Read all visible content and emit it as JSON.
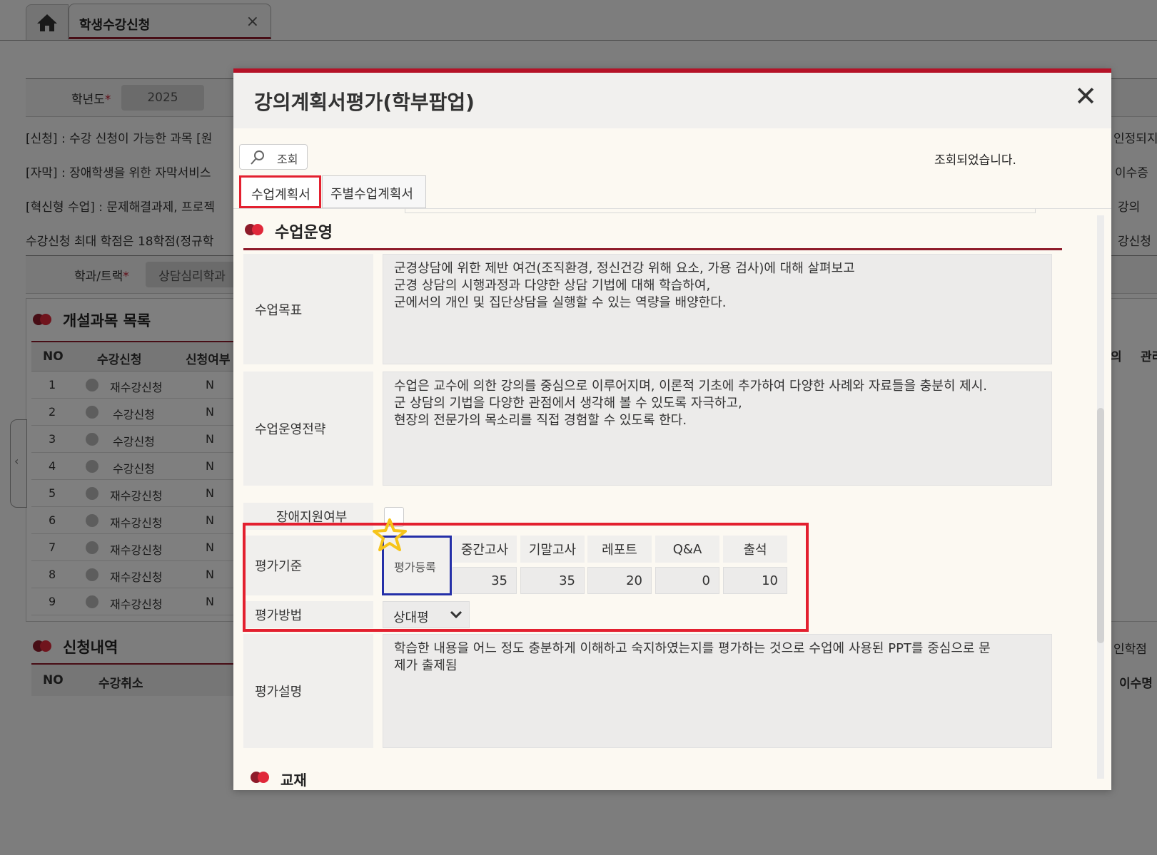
{
  "background": {
    "app_tab": {
      "label": "학생수강신청",
      "close": "×"
    },
    "year": {
      "label": "학년도",
      "required": "*",
      "value": "2025"
    },
    "notes": [
      "[신청] : 수강 신청이 가능한 과목 [원",
      "[자막] : 장애학생을 위한 자막서비스",
      "[혁신형 수업] : 문제해결과제, 프로젝",
      "수강신청 최대 학점은 18학점(정규학"
    ],
    "notes_right": [
      "인정되지",
      "이수증",
      "강의",
      "강신청"
    ],
    "dept": {
      "label": "학과/트랙",
      "required": "*",
      "value": "상담심리학과"
    },
    "course_list": {
      "title": "개설과목 목록",
      "headers": [
        "NO",
        "수강신청",
        "신청여부"
      ],
      "right_headers": [
        "의",
        "관리"
      ],
      "rows": [
        {
          "no": "1",
          "action": "재수강신청",
          "status": "N"
        },
        {
          "no": "2",
          "action": "수강신청",
          "status": "N"
        },
        {
          "no": "3",
          "action": "수강신청",
          "status": "N"
        },
        {
          "no": "4",
          "action": "수강신청",
          "status": "N"
        },
        {
          "no": "5",
          "action": "재수강신청",
          "status": "N"
        },
        {
          "no": "6",
          "action": "재수강신청",
          "status": "N"
        },
        {
          "no": "7",
          "action": "재수강신청",
          "status": "N"
        },
        {
          "no": "8",
          "action": "재수강신청",
          "status": "N"
        },
        {
          "no": "9",
          "action": "재수강신청",
          "status": "N"
        }
      ]
    },
    "applied": {
      "title": "신청내역",
      "headers": [
        "NO",
        "수강취소"
      ],
      "right_label": "인학점",
      "right_header": "이수명"
    }
  },
  "modal": {
    "title": "강의계획서평가(학부팝업)",
    "close": "✕",
    "search_label": "조회",
    "status_message": "조회되었습니다.",
    "tabs": [
      {
        "label": "수업계획서",
        "active": true
      },
      {
        "label": "주별수업계획서",
        "active": false
      }
    ],
    "section_title": "수업운영",
    "fields": {
      "goal_label": "수업목표",
      "goal_text": "군경상담에 위한 제반 여건(조직환경, 정신건강 위해 요소, 가용 검사)에 대해 살펴보고\n군경 상담의 시행과정과 다양한 상담 기법에 대해 학습하여,\n군에서의 개인 및 집단상담을 실행할 수 있는 역량을 배양한다.",
      "strategy_label": "수업운영전략",
      "strategy_text": "수업은 교수에 의한 강의를 중심으로 이루어지며, 이론적 기초에 추가하여 다양한 사례와 자료들을 충분히 제시.\n군 상담의 기법을 다양한 관점에서 생각해 볼 수 있도록 자극하고,\n현장의 전문가의 목소리를 직접 경험할 수 있도록 한다.",
      "disability_label": "장애지원여부",
      "criteria_label": "평가기준",
      "register_label": "평가등록",
      "criteria_headers": [
        "중간고사",
        "기말고사",
        "레포트",
        "Q&A",
        "출석"
      ],
      "criteria_values": [
        "35",
        "35",
        "20",
        "0",
        "10"
      ],
      "method_label": "평가방법",
      "method_value": "상대평",
      "desc_label": "평가설명",
      "desc_text": "학습한 내용을 어느 정도 충분하게 이해하고 숙지하였는지를 평가하는 것으로 수업에 사용된 PPT를 중심으로 문\n제가 출제됨"
    },
    "next_section": "교재"
  },
  "colors": {
    "accent": "#b51227",
    "highlight_red": "#e3202f",
    "highlight_blue": "#2530a8",
    "star": "#f6c419"
  }
}
